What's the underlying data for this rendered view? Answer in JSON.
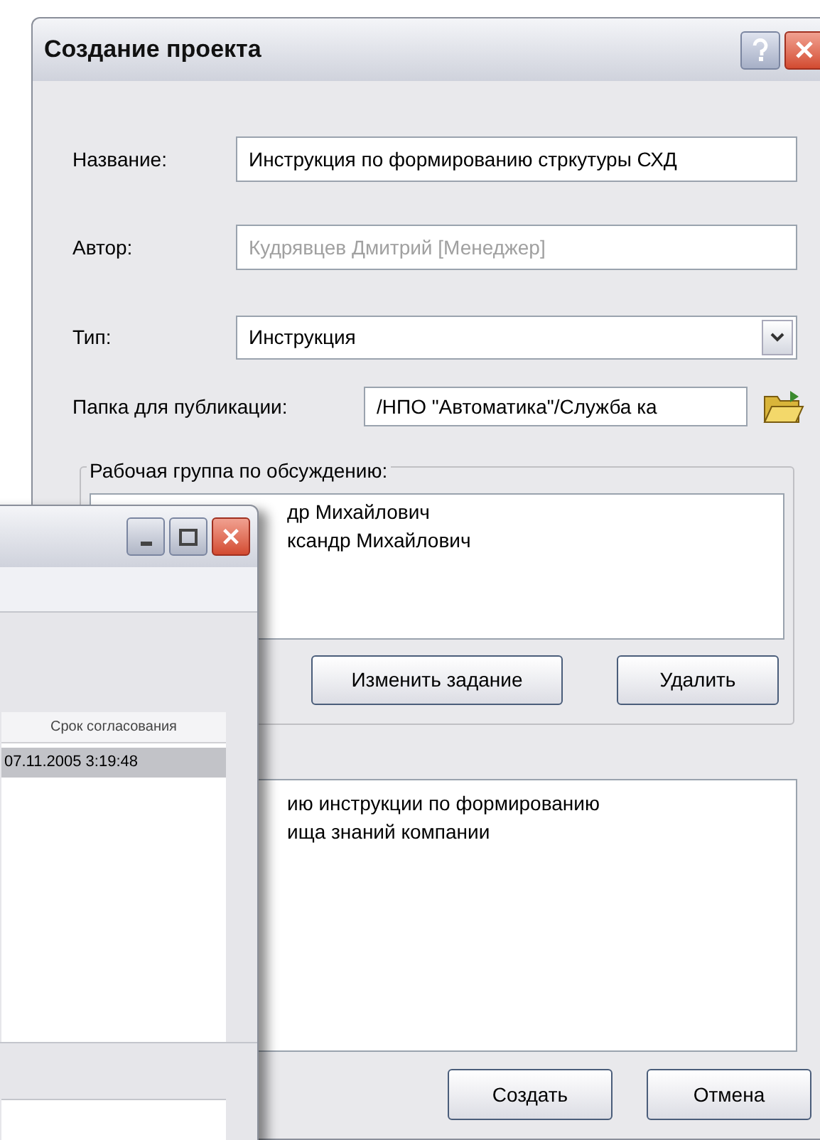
{
  "dialog": {
    "title": "Создание проекта",
    "fields": [
      {
        "kind": "text",
        "label": "Название:",
        "value": "Инструкция по формированию стркутуры СХД",
        "disabled": false
      },
      {
        "kind": "text",
        "label": "Автор:",
        "value": "Кудрявцев Дмитрий  [Менеджер]",
        "disabled": true
      },
      {
        "kind": "select",
        "label": "Тип:",
        "value": "Инструкция",
        "disabled": false
      },
      {
        "kind": "folder",
        "label": "Папка для публикации:",
        "value": "/НПО \"Автоматика\"/Служба ка",
        "disabled": false
      }
    ],
    "workgroup": {
      "legend": "Рабочая группа по обсуждению:",
      "members": [
        "др Михайлович",
        "ксандр Михайлович"
      ],
      "buttons": [
        "Изменить задание",
        "Удалить"
      ]
    },
    "description": [
      "ию инструкции по формированию",
      "ища знаний компании"
    ],
    "buttons": [
      "Создать",
      "Отмена"
    ]
  },
  "task_window": {
    "table": {
      "columns": [
        "Срок согласования"
      ],
      "rows": [
        {
          "cells": [
            "07.11.2005 3:19:48"
          ],
          "selected": true
        }
      ]
    }
  }
}
